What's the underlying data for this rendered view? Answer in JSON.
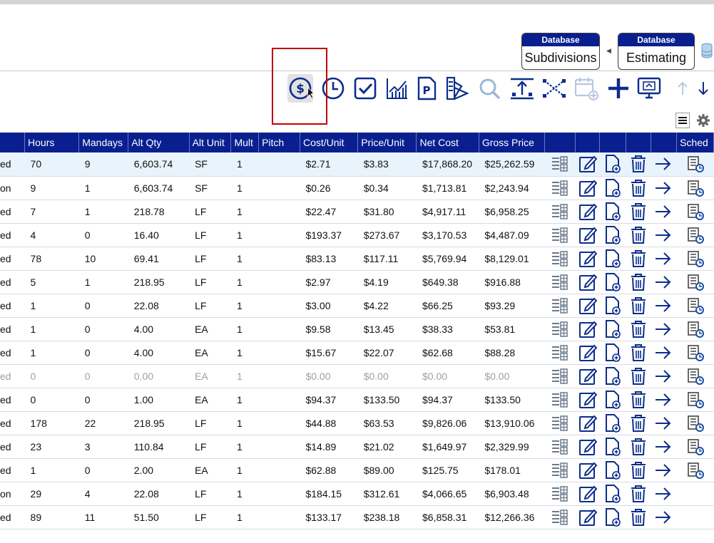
{
  "header": {
    "db_buttons": [
      {
        "caption": "Database",
        "label": "Subdivisions"
      },
      {
        "caption": "Database",
        "label": "Estimating"
      }
    ]
  },
  "toolbar": {
    "icons": [
      "dollar-circle-icon",
      "clock-icon",
      "checkbox-icon",
      "line-chart-icon",
      "parking-doc-icon",
      "swatch-icon",
      "refresh-search-icon",
      "distribute-icon",
      "shuffle-icon",
      "calendar-add-icon",
      "add-icon",
      "monitor-icon",
      "arrow-up-icon",
      "arrow-down-icon"
    ],
    "menu_icon": "hamburger-menu-icon",
    "settings_icon": "gear-icon"
  },
  "table": {
    "columns": [
      "",
      "Hours",
      "Mandays",
      "Alt Qty",
      "Alt Unit",
      "Mult",
      "Pitch",
      "Cost/Unit",
      "Price/Unit",
      "Net Cost",
      "Gross Price",
      "",
      "",
      "",
      "",
      "",
      "Sched"
    ],
    "rows": [
      {
        "status": "ed",
        "hours": "70",
        "mandays": "9",
        "alt_qty": "6,603.74",
        "alt_unit": "SF",
        "mult": "1",
        "pitch": "",
        "cost_unit": "$2.71",
        "price_unit": "$3.83",
        "net_cost": "$17,868.20",
        "gross_price": "$25,262.59",
        "sched": true,
        "dim": false
      },
      {
        "status": "on",
        "hours": "9",
        "mandays": "1",
        "alt_qty": "6,603.74",
        "alt_unit": "SF",
        "mult": "1",
        "pitch": "",
        "cost_unit": "$0.26",
        "price_unit": "$0.34",
        "net_cost": "$1,713.81",
        "gross_price": "$2,243.94",
        "sched": true,
        "dim": false
      },
      {
        "status": "ed",
        "hours": "7",
        "mandays": "1",
        "alt_qty": "218.78",
        "alt_unit": "LF",
        "mult": "1",
        "pitch": "",
        "cost_unit": "$22.47",
        "price_unit": "$31.80",
        "net_cost": "$4,917.11",
        "gross_price": "$6,958.25",
        "sched": true,
        "dim": false
      },
      {
        "status": "ed",
        "hours": "4",
        "mandays": "0",
        "alt_qty": "16.40",
        "alt_unit": "LF",
        "mult": "1",
        "pitch": "",
        "cost_unit": "$193.37",
        "price_unit": "$273.67",
        "net_cost": "$3,170.53",
        "gross_price": "$4,487.09",
        "sched": true,
        "dim": false
      },
      {
        "status": "ed",
        "hours": "78",
        "mandays": "10",
        "alt_qty": "69.41",
        "alt_unit": "LF",
        "mult": "1",
        "pitch": "",
        "cost_unit": "$83.13",
        "price_unit": "$117.11",
        "net_cost": "$5,769.94",
        "gross_price": "$8,129.01",
        "sched": true,
        "dim": false
      },
      {
        "status": "ed",
        "hours": "5",
        "mandays": "1",
        "alt_qty": "218.95",
        "alt_unit": "LF",
        "mult": "1",
        "pitch": "",
        "cost_unit": "$2.97",
        "price_unit": "$4.19",
        "net_cost": "$649.38",
        "gross_price": "$916.88",
        "sched": true,
        "dim": false
      },
      {
        "status": "ed",
        "hours": "1",
        "mandays": "0",
        "alt_qty": "22.08",
        "alt_unit": "LF",
        "mult": "1",
        "pitch": "",
        "cost_unit": "$3.00",
        "price_unit": "$4.22",
        "net_cost": "$66.25",
        "gross_price": "$93.29",
        "sched": true,
        "dim": false
      },
      {
        "status": "ed",
        "hours": "1",
        "mandays": "0",
        "alt_qty": "4.00",
        "alt_unit": "EA",
        "mult": "1",
        "pitch": "",
        "cost_unit": "$9.58",
        "price_unit": "$13.45",
        "net_cost": "$38.33",
        "gross_price": "$53.81",
        "sched": true,
        "dim": false
      },
      {
        "status": "ed",
        "hours": "1",
        "mandays": "0",
        "alt_qty": "4.00",
        "alt_unit": "EA",
        "mult": "1",
        "pitch": "",
        "cost_unit": "$15.67",
        "price_unit": "$22.07",
        "net_cost": "$62.68",
        "gross_price": "$88.28",
        "sched": true,
        "dim": false
      },
      {
        "status": "ed",
        "hours": "0",
        "mandays": "0",
        "alt_qty": "0.00",
        "alt_unit": "EA",
        "mult": "1",
        "pitch": "",
        "cost_unit": "$0.00",
        "price_unit": "$0.00",
        "net_cost": "$0.00",
        "gross_price": "$0.00",
        "sched": true,
        "dim": true
      },
      {
        "status": "ed",
        "hours": "0",
        "mandays": "0",
        "alt_qty": "1.00",
        "alt_unit": "EA",
        "mult": "1",
        "pitch": "",
        "cost_unit": "$94.37",
        "price_unit": "$133.50",
        "net_cost": "$94.37",
        "gross_price": "$133.50",
        "sched": true,
        "dim": false
      },
      {
        "status": "ed",
        "hours": "178",
        "mandays": "22",
        "alt_qty": "218.95",
        "alt_unit": "LF",
        "mult": "1",
        "pitch": "",
        "cost_unit": "$44.88",
        "price_unit": "$63.53",
        "net_cost": "$9,826.06",
        "gross_price": "$13,910.06",
        "sched": true,
        "dim": false
      },
      {
        "status": "ed",
        "hours": "23",
        "mandays": "3",
        "alt_qty": "110.84",
        "alt_unit": "LF",
        "mult": "1",
        "pitch": "",
        "cost_unit": "$14.89",
        "price_unit": "$21.02",
        "net_cost": "$1,649.97",
        "gross_price": "$2,329.99",
        "sched": true,
        "dim": false
      },
      {
        "status": "ed",
        "hours": "1",
        "mandays": "0",
        "alt_qty": "2.00",
        "alt_unit": "EA",
        "mult": "1",
        "pitch": "",
        "cost_unit": "$62.88",
        "price_unit": "$89.00",
        "net_cost": "$125.75",
        "gross_price": "$178.01",
        "sched": true,
        "dim": false
      },
      {
        "status": "on",
        "hours": "29",
        "mandays": "4",
        "alt_qty": "22.08",
        "alt_unit": "LF",
        "mult": "1",
        "pitch": "",
        "cost_unit": "$184.15",
        "price_unit": "$312.61",
        "net_cost": "$4,066.65",
        "gross_price": "$6,903.48",
        "sched": false,
        "dim": false
      },
      {
        "status": "ed",
        "hours": "89",
        "mandays": "11",
        "alt_qty": "51.50",
        "alt_unit": "LF",
        "mult": "1",
        "pitch": "",
        "cost_unit": "$133.17",
        "price_unit": "$238.18",
        "net_cost": "$6,858.31",
        "gross_price": "$12,266.36",
        "sched": false,
        "dim": false
      }
    ],
    "row_icons": [
      "grid-list-icon",
      "edit-icon",
      "add-document-icon",
      "trash-icon",
      "arrow-right-icon",
      "schedule-icon"
    ]
  },
  "colors": {
    "header_bg": "#0a1f8f",
    "icon_blue": "#0b2d8c",
    "highlight": "#c00000"
  }
}
